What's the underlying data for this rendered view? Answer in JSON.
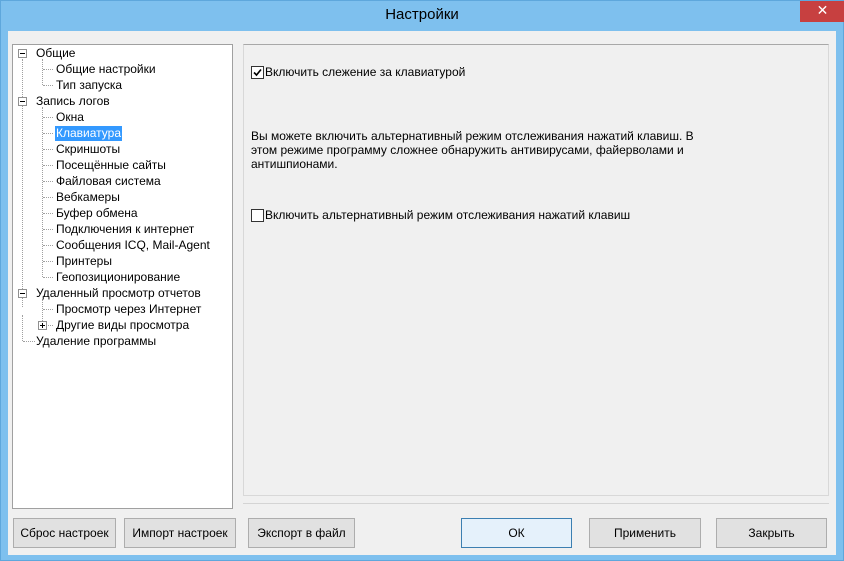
{
  "window": {
    "title": "Настройки",
    "close_glyph": "✕"
  },
  "tree": {
    "items": [
      {
        "label": "Общие"
      },
      {
        "label": "Общие настройки"
      },
      {
        "label": "Тип запуска"
      },
      {
        "label": "Запись логов"
      },
      {
        "label": "Окна"
      },
      {
        "label": "Клавиатура"
      },
      {
        "label": "Скриншоты"
      },
      {
        "label": "Посещённые сайты"
      },
      {
        "label": "Файловая система"
      },
      {
        "label": "Вебкамеры"
      },
      {
        "label": "Буфер обмена"
      },
      {
        "label": "Подключения к интернет"
      },
      {
        "label": "Сообщения ICQ, Mail-Agent"
      },
      {
        "label": "Принтеры"
      },
      {
        "label": "Геопозиционирование"
      },
      {
        "label": "Удаленный просмотр отчетов"
      },
      {
        "label": "Просмотр через Интернет"
      },
      {
        "label": "Другие виды просмотра"
      },
      {
        "label": "Удаление программы"
      }
    ],
    "selected": "Клавиатура"
  },
  "panel": {
    "enable_keyboard": {
      "label": "Включить слежение за клавиатурой",
      "checked": true
    },
    "description": "Вы можете включить альтернативный режим отслеживания нажатий клавиш. В этом режиме программу сложнее обнаружить антивирусами, файерволами и антишпионами.",
    "alt_mode": {
      "label": "Включить альтернативный режим отслеживания нажатий клавиш",
      "checked": false
    }
  },
  "buttons": {
    "reset": "Сброс настроек",
    "import": "Импорт настроек",
    "export": "Экспорт в файл",
    "ok": "ОК",
    "apply": "Применить",
    "close": "Закрыть"
  },
  "colors": {
    "title_bar": "#7ec0ee",
    "selection": "#3399ff",
    "close_button": "#c74040"
  }
}
